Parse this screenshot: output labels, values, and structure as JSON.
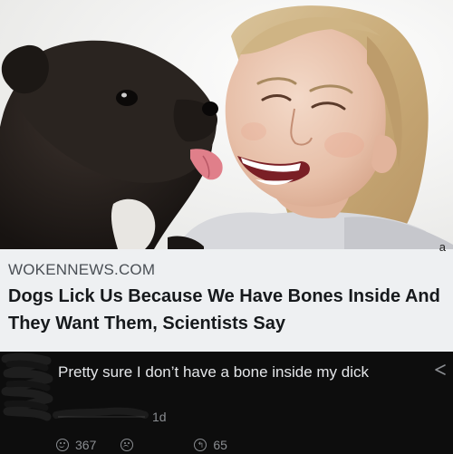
{
  "post": {
    "link_domain": "WOKENNEWS.COM",
    "headline": "Dogs Lick Us Because We Have Bones Inside And They Want Them, Scientists Say",
    "corner_mark": "a"
  },
  "comment": {
    "text": "Pretty sure I don’t have a bone inside my dick",
    "timestamp": "1d",
    "reactions": {
      "positive_count": "367",
      "reply_count": "65"
    }
  },
  "icons": {
    "share": "share-icon",
    "smile": "smile-reaction-icon",
    "frown": "frown-reaction-icon",
    "reply": "reply-icon"
  },
  "colors": {
    "card_background": "#eef0f2",
    "comment_background": "#0d0d0d",
    "headline_text": "#16191c",
    "comment_text": "#e4e6e9",
    "meta_text": "#8a8d91"
  }
}
